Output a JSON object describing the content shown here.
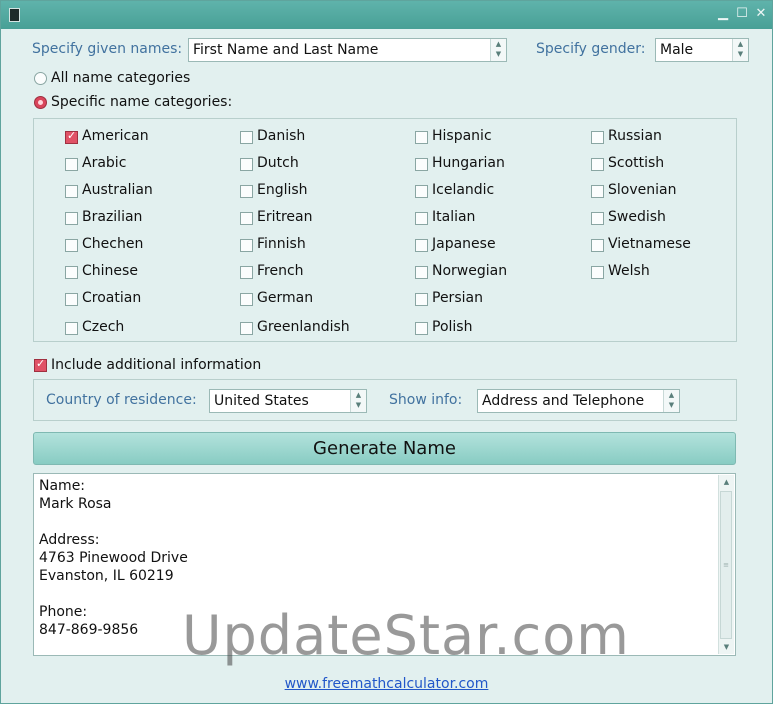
{
  "window": {
    "title": "",
    "controls": [
      "minimize-icon",
      "maximize-icon",
      "close-icon"
    ],
    "accent_color": "#4fa79d"
  },
  "given_names": {
    "label": "Specify given names:",
    "value": "First Name and Last Name"
  },
  "gender": {
    "label": "Specify gender:",
    "value": "Male"
  },
  "categories_mode": {
    "all_label": "All name categories",
    "specific_label": "Specific name categories:",
    "selected": "specific"
  },
  "categories": [
    {
      "label": "American",
      "checked": true
    },
    {
      "label": "Arabic",
      "checked": false
    },
    {
      "label": "Australian",
      "checked": false
    },
    {
      "label": "Brazilian",
      "checked": false
    },
    {
      "label": "Chechen",
      "checked": false
    },
    {
      "label": "Chinese",
      "checked": false
    },
    {
      "label": "Croatian",
      "checked": false
    },
    {
      "label": "Czech",
      "checked": false
    },
    {
      "label": "Danish",
      "checked": false
    },
    {
      "label": "Dutch",
      "checked": false
    },
    {
      "label": "English",
      "checked": false
    },
    {
      "label": "Eritrean",
      "checked": false
    },
    {
      "label": "Finnish",
      "checked": false
    },
    {
      "label": "French",
      "checked": false
    },
    {
      "label": "German",
      "checked": false
    },
    {
      "label": "Greenlandish",
      "checked": false
    },
    {
      "label": "Hispanic",
      "checked": false
    },
    {
      "label": "Hungarian",
      "checked": false
    },
    {
      "label": "Icelandic",
      "checked": false
    },
    {
      "label": "Italian",
      "checked": false
    },
    {
      "label": "Japanese",
      "checked": false
    },
    {
      "label": "Norwegian",
      "checked": false
    },
    {
      "label": "Persian",
      "checked": false
    },
    {
      "label": "Polish",
      "checked": false
    },
    {
      "label": "Russian",
      "checked": false
    },
    {
      "label": "Scottish",
      "checked": false
    },
    {
      "label": "Slovenian",
      "checked": false
    },
    {
      "label": "Swedish",
      "checked": false
    },
    {
      "label": "Vietnamese",
      "checked": false
    },
    {
      "label": "Welsh",
      "checked": false
    }
  ],
  "additional": {
    "label": "Include additional information",
    "checked": true,
    "country_label": "Country of residence:",
    "country_value": "United States",
    "show_info_label": "Show info:",
    "show_info_value": "Address and Telephone"
  },
  "generate_button": "Generate Name",
  "output": {
    "text": "Name:\nMark Rosa\n\nAddress:\n4763 Pinewood Drive\nEvanston, IL 60219\n\nPhone:\n847-869-9856"
  },
  "watermark": "UpdateStar.com",
  "footer_link": "www.freemathcalculator.com"
}
